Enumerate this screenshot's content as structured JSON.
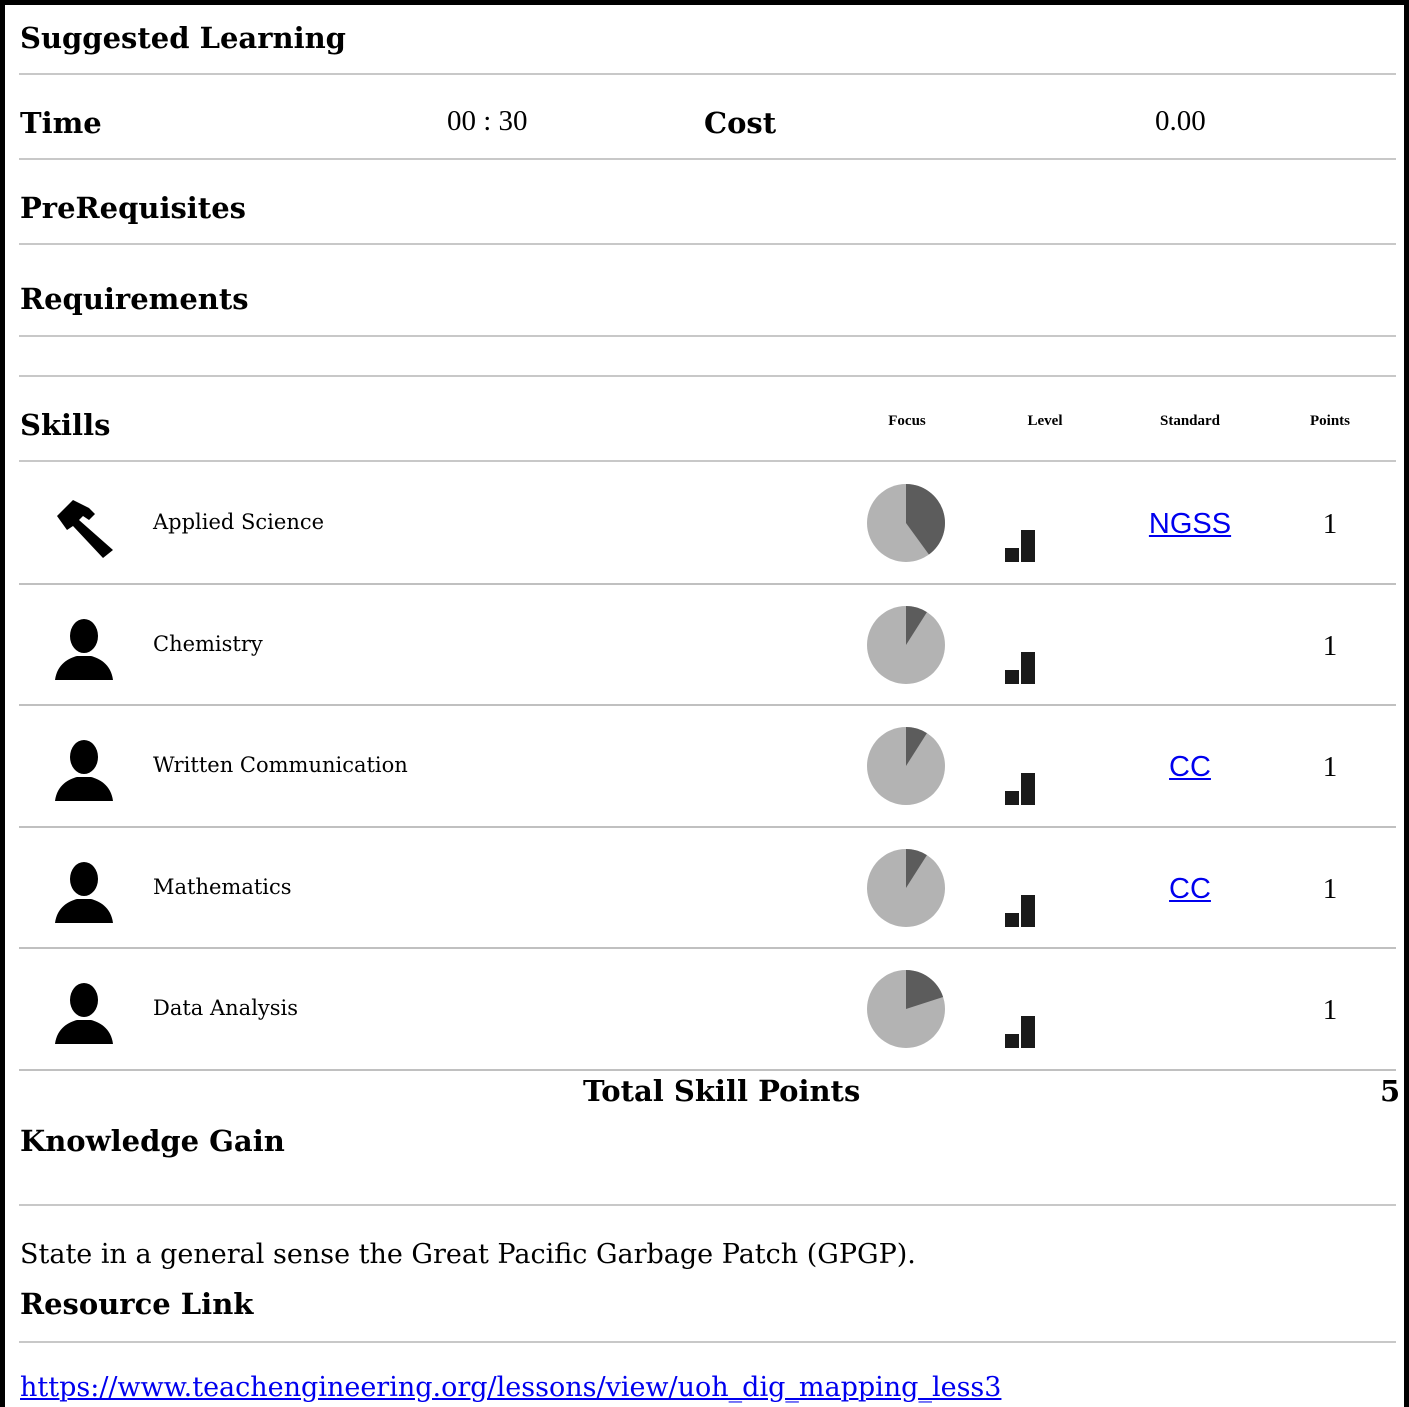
{
  "section": {
    "title": "Suggested Learning",
    "time_label": "Time",
    "time_value": "00 : 30",
    "cost_label": "Cost",
    "cost_value": "0.00",
    "prereq_label": "PreRequisites",
    "requirements_label": "Requirements"
  },
  "skills": {
    "title": "Skills",
    "headers": {
      "focus": "Focus",
      "level": "Level",
      "standard": "Standard",
      "points": "Points"
    },
    "rows": [
      {
        "icon": "hammer-icon",
        "name": "Applied Science",
        "focus_fraction": 0.4,
        "level": 2,
        "standard": "NGSS",
        "points": "1"
      },
      {
        "icon": "person-icon",
        "name": "Chemistry",
        "focus_fraction": 0.09,
        "level": 2,
        "standard": "",
        "points": "1"
      },
      {
        "icon": "person-icon",
        "name": "Written Communication",
        "focus_fraction": 0.09,
        "level": 2,
        "standard": "CC",
        "points": "1"
      },
      {
        "icon": "person-icon",
        "name": "Mathematics",
        "focus_fraction": 0.09,
        "level": 2,
        "standard": "CC",
        "points": "1"
      },
      {
        "icon": "person-icon",
        "name": "Data Analysis",
        "focus_fraction": 0.2,
        "level": 2,
        "standard": "",
        "points": "1"
      }
    ],
    "total_label": "Total Skill Points",
    "total_value": "5"
  },
  "knowledge": {
    "title": "Knowledge Gain",
    "text": "State in a general sense the Great Pacific Garbage Patch (GPGP)."
  },
  "resource": {
    "title": "Resource Link",
    "url": "https://www.teachengineering.org/lessons/view/uoh_dig_mapping_less3"
  },
  "colors": {
    "pie_light": "#b3b3b3",
    "pie_dark": "#5c5c5c",
    "link": "#0000ee",
    "rule": "#c8c8c8"
  }
}
